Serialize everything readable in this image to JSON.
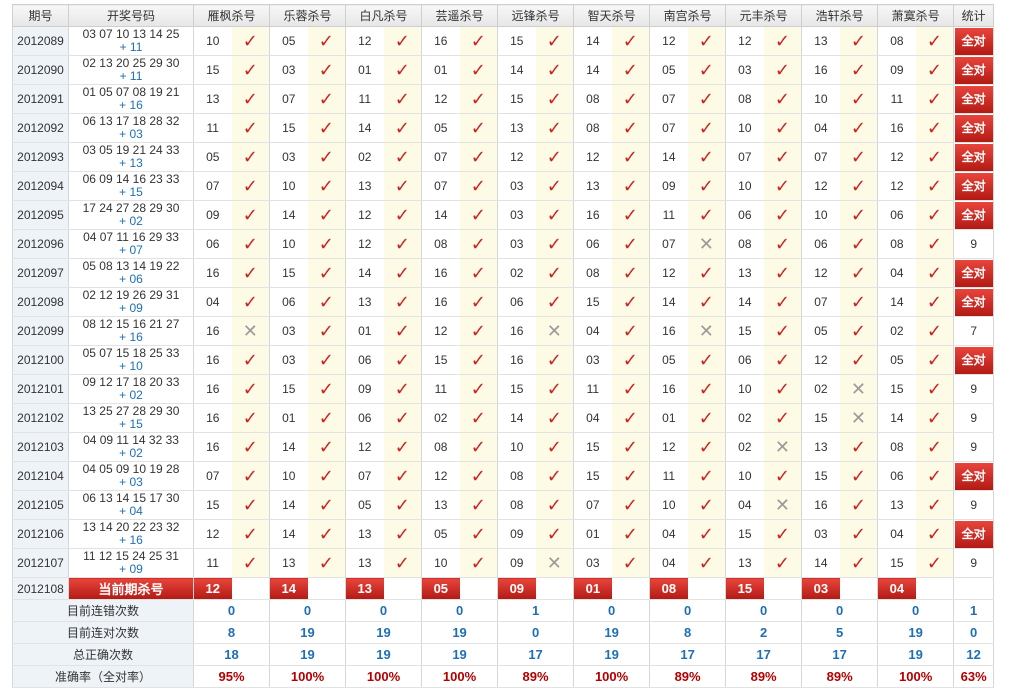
{
  "headers": {
    "issue": "期号",
    "draw": "开奖号码",
    "predictors": [
      "雁枫杀号",
      "乐蓉杀号",
      "白凡杀号",
      "芸遥杀号",
      "远锋杀号",
      "智天杀号",
      "南宫杀号",
      "元丰杀号",
      "浩轩杀号",
      "萧寞杀号"
    ],
    "stat": "统计"
  },
  "icons": {
    "hit": "check-icon",
    "miss": "cross-icon"
  },
  "rows": [
    {
      "issue": "2012089",
      "red": "03 07 10 13 14 25",
      "blue": "+ 11",
      "nums": [
        "10",
        "05",
        "12",
        "16",
        "15",
        "14",
        "12",
        "12",
        "13",
        "08"
      ],
      "hits": [
        1,
        1,
        1,
        1,
        1,
        1,
        1,
        1,
        1,
        1
      ],
      "stat": "全对",
      "all": true
    },
    {
      "issue": "2012090",
      "red": "02 13 20 25 29 30",
      "blue": "+ 11",
      "nums": [
        "15",
        "03",
        "01",
        "01",
        "14",
        "14",
        "05",
        "03",
        "16",
        "09"
      ],
      "hits": [
        1,
        1,
        1,
        1,
        1,
        1,
        1,
        1,
        1,
        1
      ],
      "stat": "全对",
      "all": true
    },
    {
      "issue": "2012091",
      "red": "01 05 07 08 19 21",
      "blue": "+ 16",
      "nums": [
        "13",
        "07",
        "11",
        "12",
        "15",
        "08",
        "07",
        "08",
        "10",
        "11"
      ],
      "hits": [
        1,
        1,
        1,
        1,
        1,
        1,
        1,
        1,
        1,
        1
      ],
      "stat": "全对",
      "all": true
    },
    {
      "issue": "2012092",
      "red": "06 13 17 18 28 32",
      "blue": "+ 03",
      "nums": [
        "11",
        "15",
        "14",
        "05",
        "13",
        "08",
        "07",
        "10",
        "04",
        "16"
      ],
      "hits": [
        1,
        1,
        1,
        1,
        1,
        1,
        1,
        1,
        1,
        1
      ],
      "stat": "全对",
      "all": true
    },
    {
      "issue": "2012093",
      "red": "03 05 19 21 24 33",
      "blue": "+ 13",
      "nums": [
        "05",
        "03",
        "02",
        "07",
        "12",
        "12",
        "14",
        "07",
        "07",
        "12"
      ],
      "hits": [
        1,
        1,
        1,
        1,
        1,
        1,
        1,
        1,
        1,
        1
      ],
      "stat": "全对",
      "all": true
    },
    {
      "issue": "2012094",
      "red": "06 09 14 16 23 33",
      "blue": "+ 15",
      "nums": [
        "07",
        "10",
        "13",
        "07",
        "03",
        "13",
        "09",
        "10",
        "12",
        "12"
      ],
      "hits": [
        1,
        1,
        1,
        1,
        1,
        1,
        1,
        1,
        1,
        1
      ],
      "stat": "全对",
      "all": true
    },
    {
      "issue": "2012095",
      "red": "17 24 27 28 29 30",
      "blue": "+ 02",
      "nums": [
        "09",
        "14",
        "12",
        "14",
        "03",
        "16",
        "11",
        "06",
        "10",
        "06"
      ],
      "hits": [
        1,
        1,
        1,
        1,
        1,
        1,
        1,
        1,
        1,
        1
      ],
      "stat": "全对",
      "all": true
    },
    {
      "issue": "2012096",
      "red": "04 07 11 16 29 33",
      "blue": "+ 07",
      "nums": [
        "06",
        "10",
        "12",
        "08",
        "03",
        "06",
        "07",
        "08",
        "06",
        "08"
      ],
      "hits": [
        1,
        1,
        1,
        1,
        1,
        1,
        0,
        1,
        1,
        1
      ],
      "stat": "9",
      "all": false
    },
    {
      "issue": "2012097",
      "red": "05 08 13 14 19 22",
      "blue": "+ 06",
      "nums": [
        "16",
        "15",
        "14",
        "16",
        "02",
        "08",
        "12",
        "13",
        "12",
        "04"
      ],
      "hits": [
        1,
        1,
        1,
        1,
        1,
        1,
        1,
        1,
        1,
        1
      ],
      "stat": "全对",
      "all": true
    },
    {
      "issue": "2012098",
      "red": "02 12 19 26 29 31",
      "blue": "+ 09",
      "nums": [
        "04",
        "06",
        "13",
        "16",
        "06",
        "15",
        "14",
        "14",
        "07",
        "14"
      ],
      "hits": [
        1,
        1,
        1,
        1,
        1,
        1,
        1,
        1,
        1,
        1
      ],
      "stat": "全对",
      "all": true
    },
    {
      "issue": "2012099",
      "red": "08 12 15 16 21 27",
      "blue": "+ 16",
      "nums": [
        "16",
        "03",
        "01",
        "12",
        "16",
        "04",
        "16",
        "15",
        "05",
        "02"
      ],
      "hits": [
        0,
        1,
        1,
        1,
        0,
        1,
        0,
        1,
        1,
        1
      ],
      "stat": "7",
      "all": false
    },
    {
      "issue": "2012100",
      "red": "05 07 15 18 25 33",
      "blue": "+ 10",
      "nums": [
        "16",
        "03",
        "06",
        "15",
        "16",
        "03",
        "05",
        "06",
        "12",
        "05"
      ],
      "hits": [
        1,
        1,
        1,
        1,
        1,
        1,
        1,
        1,
        1,
        1
      ],
      "stat": "全对",
      "all": true
    },
    {
      "issue": "2012101",
      "red": "09 12 17 18 20 33",
      "blue": "+ 02",
      "nums": [
        "16",
        "15",
        "09",
        "11",
        "15",
        "11",
        "16",
        "10",
        "02",
        "15"
      ],
      "hits": [
        1,
        1,
        1,
        1,
        1,
        1,
        1,
        1,
        0,
        1
      ],
      "stat": "9",
      "all": false
    },
    {
      "issue": "2012102",
      "red": "13 25 27 28 29 30",
      "blue": "+ 15",
      "nums": [
        "16",
        "01",
        "06",
        "02",
        "14",
        "04",
        "01",
        "02",
        "15",
        "14"
      ],
      "hits": [
        1,
        1,
        1,
        1,
        1,
        1,
        1,
        1,
        0,
        1
      ],
      "stat": "9",
      "all": false
    },
    {
      "issue": "2012103",
      "red": "04 09 11 14 32 33",
      "blue": "+ 02",
      "nums": [
        "16",
        "14",
        "12",
        "08",
        "10",
        "15",
        "12",
        "02",
        "13",
        "08"
      ],
      "hits": [
        1,
        1,
        1,
        1,
        1,
        1,
        1,
        0,
        1,
        1
      ],
      "stat": "9",
      "all": false
    },
    {
      "issue": "2012104",
      "red": "04 05 09 10 19 28",
      "blue": "+ 03",
      "nums": [
        "07",
        "10",
        "07",
        "12",
        "08",
        "15",
        "11",
        "10",
        "15",
        "06"
      ],
      "hits": [
        1,
        1,
        1,
        1,
        1,
        1,
        1,
        1,
        1,
        1
      ],
      "stat": "全对",
      "all": true
    },
    {
      "issue": "2012105",
      "red": "06 13 14 15 17 30",
      "blue": "+ 04",
      "nums": [
        "15",
        "14",
        "05",
        "13",
        "08",
        "07",
        "10",
        "04",
        "16",
        "13"
      ],
      "hits": [
        1,
        1,
        1,
        1,
        1,
        1,
        1,
        0,
        1,
        1
      ],
      "stat": "9",
      "all": false
    },
    {
      "issue": "2012106",
      "red": "13 14 20 22 23 32",
      "blue": "+ 16",
      "nums": [
        "12",
        "14",
        "13",
        "05",
        "09",
        "01",
        "04",
        "15",
        "03",
        "04"
      ],
      "hits": [
        1,
        1,
        1,
        1,
        1,
        1,
        1,
        1,
        1,
        1
      ],
      "stat": "全对",
      "all": true
    },
    {
      "issue": "2012107",
      "red": "11 12 15 24 25 31",
      "blue": "+ 09",
      "nums": [
        "11",
        "13",
        "13",
        "10",
        "09",
        "03",
        "04",
        "13",
        "14",
        "15"
      ],
      "hits": [
        1,
        1,
        1,
        1,
        0,
        1,
        1,
        1,
        1,
        1
      ],
      "stat": "9",
      "all": false
    }
  ],
  "current": {
    "issue": "2012108",
    "label": "当前期杀号",
    "nums": [
      "12",
      "14",
      "13",
      "05",
      "09",
      "01",
      "08",
      "15",
      "03",
      "04"
    ]
  },
  "summary": [
    {
      "label": "目前连错次数",
      "values": [
        "0",
        "0",
        "0",
        "0",
        "1",
        "0",
        "0",
        "0",
        "0",
        "0"
      ],
      "stat": "1",
      "acc": false
    },
    {
      "label": "目前连对次数",
      "values": [
        "8",
        "19",
        "19",
        "19",
        "0",
        "19",
        "8",
        "2",
        "5",
        "19"
      ],
      "stat": "0",
      "acc": false
    },
    {
      "label": "总正确次数",
      "values": [
        "18",
        "19",
        "19",
        "19",
        "17",
        "19",
        "17",
        "17",
        "17",
        "19"
      ],
      "stat": "12",
      "acc": false
    },
    {
      "label": "准确率（全对率）",
      "values": [
        "95%",
        "100%",
        "100%",
        "100%",
        "89%",
        "100%",
        "89%",
        "89%",
        "89%",
        "100%"
      ],
      "stat": "63%",
      "acc": true
    }
  ]
}
